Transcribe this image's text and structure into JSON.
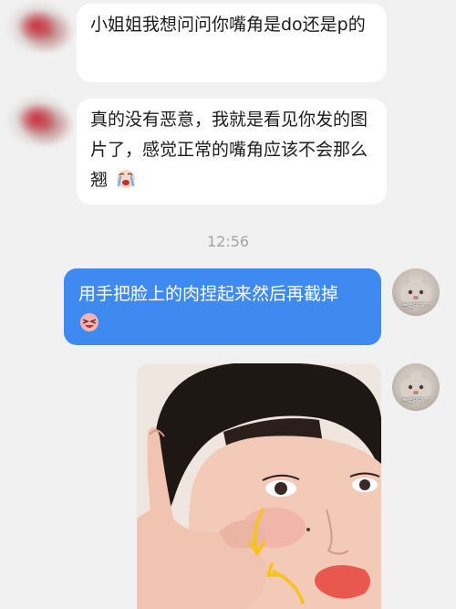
{
  "messages_in": [
    {
      "text": "小姐姐我想问问你嘴角是do还是p的"
    },
    {
      "text": "真的没有恶意，我就是看见你发的图片了，感觉正常的嘴角应该不会那么翘"
    }
  ],
  "timestamp": "12:56",
  "message_out": {
    "text": "用手把脸上的肉捏起来然后再截掉"
  },
  "avatar_right": {
    "caption": "生活碎碎了"
  },
  "icons": {
    "cry_emoji": "crying-face-emoji",
    "laugh_emoji": "squinting-face-emoji"
  },
  "colors": {
    "background": "#f1f1f1",
    "incoming_bubble": "#ffffff",
    "outgoing_bubble": "#3e8af1",
    "timestamp": "#a3a3a3",
    "annotation_arrow": "#f5c31a"
  }
}
